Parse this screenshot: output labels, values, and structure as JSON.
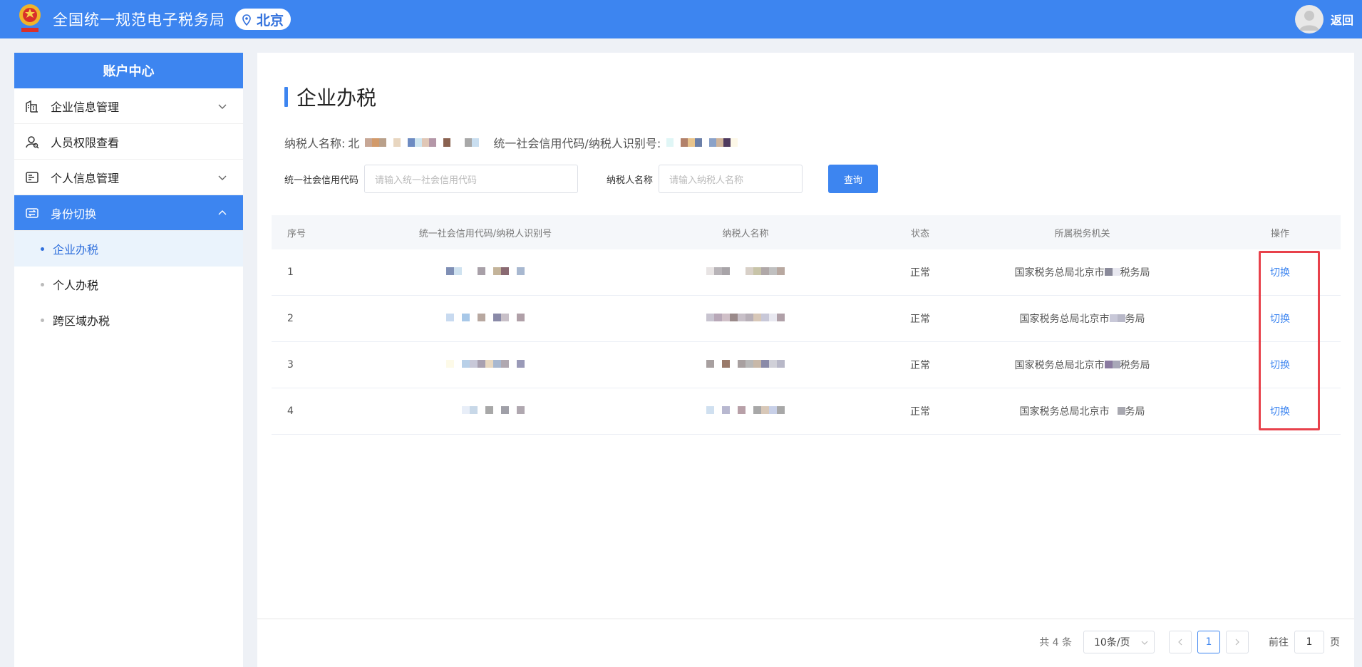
{
  "header": {
    "app_title": "全国统一规范电子税务局",
    "location": "北京",
    "back_label": "返回"
  },
  "sidebar": {
    "title": "账户中心",
    "items": [
      {
        "label": "企业信息管理",
        "icon": "building-icon",
        "chevron": "down"
      },
      {
        "label": "人员权限查看",
        "icon": "user-search-icon",
        "chevron": ""
      },
      {
        "label": "个人信息管理",
        "icon": "id-card-icon",
        "chevron": "down"
      },
      {
        "label": "身份切换",
        "icon": "switch-icon",
        "chevron": "up",
        "active": true
      }
    ],
    "subitems": [
      {
        "label": "企业办税",
        "active": true
      },
      {
        "label": "个人办税",
        "active": false
      },
      {
        "label": "跨区域办税",
        "active": false
      }
    ]
  },
  "main": {
    "title": "企业办税",
    "taxpayer_name_label": "纳税人名称:",
    "taxpayer_name_prefix": "北",
    "credit_code_label": "统一社会信用代码/纳税人识别号:",
    "search": {
      "credit_code_label": "统一社会信用代码",
      "credit_code_placeholder": "请输入统一社会信用代码",
      "name_label": "纳税人名称",
      "name_placeholder": "请输入纳税人名称",
      "query_button": "查询"
    },
    "table": {
      "columns": [
        "序号",
        "统一社会信用代码/纳税人识别号",
        "纳税人名称",
        "状态",
        "所属税务机关",
        "操作"
      ],
      "rows": [
        {
          "index": "1",
          "status": "正常",
          "authority_prefix": "国家税务总局北京市",
          "authority_suffix": "税务局",
          "action": "切换"
        },
        {
          "index": "2",
          "status": "正常",
          "authority_prefix": "国家税务总局北京市",
          "authority_suffix": "务局",
          "action": "切换"
        },
        {
          "index": "3",
          "status": "正常",
          "authority_prefix": "国家税务总局北京市",
          "authority_suffix": "税务局",
          "action": "切换"
        },
        {
          "index": "4",
          "status": "正常",
          "authority_prefix": "国家税务总局北京市",
          "authority_suffix": "务局",
          "action": "切换"
        }
      ]
    },
    "pagination": {
      "total": "共 4 条",
      "page_size": "10条/页",
      "current_page": "1",
      "goto_label": "前往",
      "goto_value": "1",
      "page_suffix": "页"
    }
  },
  "colors": {
    "brand": "#3d85f0",
    "highlight": "#e8414b"
  }
}
